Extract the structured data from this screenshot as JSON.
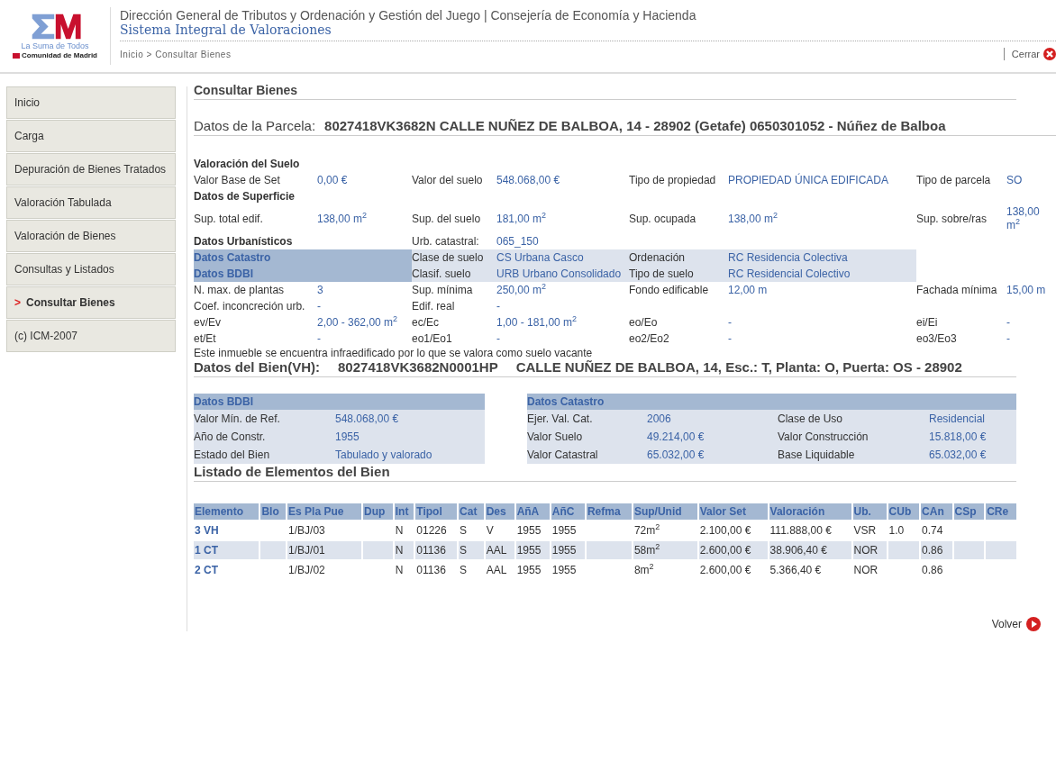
{
  "header": {
    "logo": {
      "tagline": "La Suma de Todos",
      "region": "Comunidad de Madrid"
    },
    "title": "Dirección General de Tributos y Ordenación y Gestión del Juego | Consejería de Economía y Hacienda",
    "subtitle": "Sistema Integral de Valoraciones",
    "breadcrumb": "Inicio > Consultar Bienes",
    "close": "Cerrar"
  },
  "sidebar": {
    "items": [
      {
        "label": "Inicio",
        "selected": false
      },
      {
        "label": "Carga",
        "selected": false
      },
      {
        "label": "Depuración de Bienes Tratados",
        "selected": false
      },
      {
        "label": "Valoración Tabulada",
        "selected": false
      },
      {
        "label": "Valoración de Bienes",
        "selected": false
      },
      {
        "label": "Consultas y Listados",
        "selected": false
      },
      {
        "label": "Consultar Bienes",
        "selected": true,
        "bullet": ">"
      },
      {
        "label": "(c) ICM-2007",
        "selected": false
      }
    ]
  },
  "page_title": "Consultar Bienes",
  "parcel": {
    "label": "Datos de la Parcela:",
    "value": "8027418VK3682N CALLE NUÑEZ DE BALBOA, 14 - 28902 (Getafe) 0650301052 - Núñez de Balboa",
    "rows": [
      {
        "kind": "heading",
        "title": "Valoración del Suelo"
      },
      {
        "kind": "fields",
        "fields": [
          {
            "label": "Valor Base de Set",
            "value": "0,00 €"
          },
          {
            "label": "Valor del suelo",
            "value": "548.068,00 €"
          },
          {
            "label": "Tipo de propiedad",
            "value": "PROPIEDAD ÚNICA EDIFICADA"
          },
          {
            "label": "Tipo de parcela",
            "value": "SO"
          }
        ]
      },
      {
        "kind": "heading",
        "title": "Datos de Superficie"
      },
      {
        "kind": "fields",
        "fields": [
          {
            "label": "Sup. total edif.",
            "value": "138,00 m$^{2}$"
          },
          {
            "label": "Sup. del suelo",
            "value": "181,00 m$^{2}$"
          },
          {
            "label": "Sup. ocupada",
            "value": "138,00 m$^{2}$"
          },
          {
            "label": "Sup. sobre/ras",
            "value": "138,00 m$^{2}$"
          }
        ]
      },
      {
        "kind": "heading",
        "title": "Datos Urbanísticos",
        "fields": [
          {
            "label": "Urb. catastral:",
            "value": "065_150"
          }
        ]
      },
      {
        "kind": "shaded",
        "title": "Datos Catastro",
        "fields": [
          {
            "label": "Clase de suelo",
            "value": "CS Urbana Casco"
          },
          {
            "label": "Ordenación",
            "value": "RC Residencia Colectiva"
          }
        ]
      },
      {
        "kind": "shaded",
        "title": "Datos BDBI",
        "fields": [
          {
            "label": "Clasif. suelo",
            "value": "URB Urbano Consolidado"
          },
          {
            "label": "Tipo de suelo",
            "value": "RC Residencial Colectivo"
          }
        ]
      },
      {
        "kind": "fields",
        "fields": [
          {
            "label": "N. max. de plantas",
            "value": "3"
          },
          {
            "label": "Sup. mínima",
            "value": "250,00 m$^{2}$"
          },
          {
            "label": "Fondo edificable",
            "value": "12,00 m"
          },
          {
            "label": "Fachada mínima",
            "value": "15,00 m"
          }
        ]
      },
      {
        "kind": "fields",
        "fields": [
          {
            "label": "Coef. inconcreción urb.",
            "value": "-"
          },
          {
            "label": "Edif. real",
            "value": "-"
          }
        ]
      },
      {
        "kind": "fields",
        "fields": [
          {
            "label": "ev/Ev",
            "value": "2,00 - 362,00 m$^{2}$"
          },
          {
            "label": "ec/Ec",
            "value": "1,00 - 181,00 m$^{2}$"
          },
          {
            "label": "eo/Eo",
            "value": "-"
          },
          {
            "label": "ei/Ei",
            "value": "-"
          }
        ]
      },
      {
        "kind": "fields",
        "fields": [
          {
            "label": "et/Et",
            "value": "-"
          },
          {
            "label": "eo1/Eo1",
            "value": "-"
          },
          {
            "label": "eo2/Eo2",
            "value": "-"
          },
          {
            "label": "eo3/Eo3",
            "value": "-"
          }
        ]
      }
    ],
    "note": "Este inmueble se encuentra infraedificado por lo que se valora como suelo vacante"
  },
  "property": {
    "label": "Datos del Bien(VH):",
    "reference": "8027418VK3682N0001HP",
    "address": "CALLE NUÑEZ DE BALBOA, 14, Esc.: T, Planta: O, Puerta: OS - 28902",
    "bdbi": {
      "title": "Datos BDBI",
      "rows": [
        [
          "Valor Mín. de Ref.",
          "548.068,00 €"
        ],
        [
          "Año de Constr.",
          "1955"
        ],
        [
          "Estado del Bien",
          "Tabulado y valorado"
        ]
      ]
    },
    "catastro": {
      "title": "Datos Catastro",
      "rows": [
        [
          "Ejer. Val. Cat.",
          "2006",
          "Clase de Uso",
          "Residencial"
        ],
        [
          "Valor Suelo",
          "49.214,00 €",
          "Valor Construcción",
          "15.818,00 €"
        ],
        [
          "Valor Catastral",
          "65.032,00 €",
          "Base Liquidable",
          "65.032,00 €"
        ]
      ]
    }
  },
  "elements": {
    "title": "Listado de Elementos del Bien",
    "columns": [
      "Elemento",
      "Blo",
      "Es Pla Pue",
      "Dup",
      "Int",
      "Tipol",
      "Cat",
      "Des",
      "AñA",
      "AñC",
      "Refma",
      "Sup/Unid",
      "Valor Set",
      "Valoración",
      "Ub.",
      "CUb",
      "CAn",
      "CSp",
      "CRe"
    ],
    "rows": [
      [
        "3 VH",
        null,
        "1/BJ/03",
        null,
        "N",
        "01226",
        "S",
        "V",
        "1955",
        "1955",
        null,
        "72m$^{2}$",
        "2.100,00 €",
        "111.888,00 €",
        "VSR",
        "1.0",
        "0.74",
        null,
        null
      ],
      [
        "1 CT",
        null,
        "1/BJ/01",
        null,
        "N",
        "01136",
        "S",
        "AAL",
        "1955",
        "1955",
        null,
        "58m$^{2}$",
        "2.600,00 €",
        "38.906,40 €",
        "NOR",
        null,
        "0.86",
        null,
        null
      ],
      [
        "2 CT",
        null,
        "1/BJ/02",
        null,
        "N",
        "01136",
        "S",
        "AAL",
        "1955",
        "1955",
        null,
        "8m$^{2}$",
        "2.600,00 €",
        "5.366,40 €",
        "NOR",
        null,
        "0.86",
        null,
        null
      ]
    ]
  },
  "back": "Volver"
}
